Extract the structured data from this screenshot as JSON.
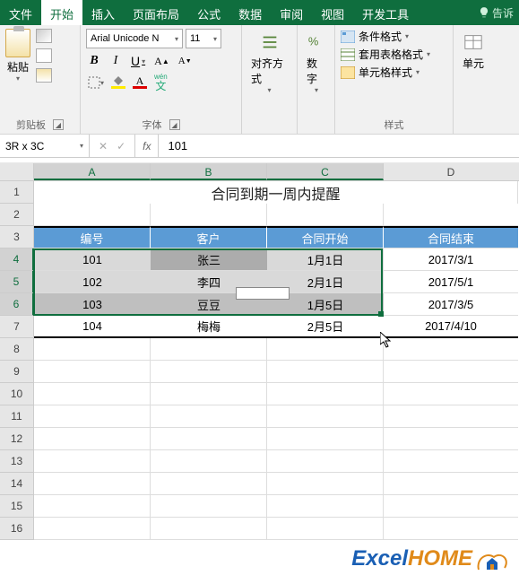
{
  "menu": {
    "file": "文件",
    "home": "开始",
    "insert": "插入",
    "layout": "页面布局",
    "formula": "公式",
    "data": "数据",
    "review": "审阅",
    "view": "视图",
    "dev": "开发工具",
    "tell": "告诉"
  },
  "ribbon": {
    "clipboard_label": "剪贴板",
    "paste": "粘贴",
    "font_label": "字体",
    "font_name": "Arial Unicode N",
    "font_size": "11",
    "bold": "B",
    "italic": "I",
    "underline": "U",
    "wen": "wén",
    "align_label": "对齐方式",
    "number_label": "数字",
    "styles_label": "样式",
    "cond_format": "条件格式",
    "table_format": "套用表格格式",
    "cell_style": "单元格样式",
    "cells_label": "单元"
  },
  "namebox": "3R x 3C",
  "fx": "fx",
  "formula_value": "101",
  "columns": [
    "A",
    "B",
    "C",
    "D"
  ],
  "rows_visible": 16,
  "title": "合同到期一周内提醒",
  "headers": {
    "a": "编号",
    "b": "客户",
    "c": "合同开始",
    "d": "合同结束"
  },
  "data_rows": [
    {
      "id": "101",
      "cust": "张三",
      "start": "1月1日",
      "end": "2017/3/1"
    },
    {
      "id": "102",
      "cust": "李四",
      "start": "2月1日",
      "end": "2017/5/1"
    },
    {
      "id": "103",
      "cust": "豆豆",
      "start": "1月5日",
      "end": "2017/3/5"
    },
    {
      "id": "104",
      "cust": "梅梅",
      "start": "2月5日",
      "end": "2017/4/10"
    }
  ],
  "watermark": {
    "part1": "Excel",
    "part2": "HOME"
  }
}
